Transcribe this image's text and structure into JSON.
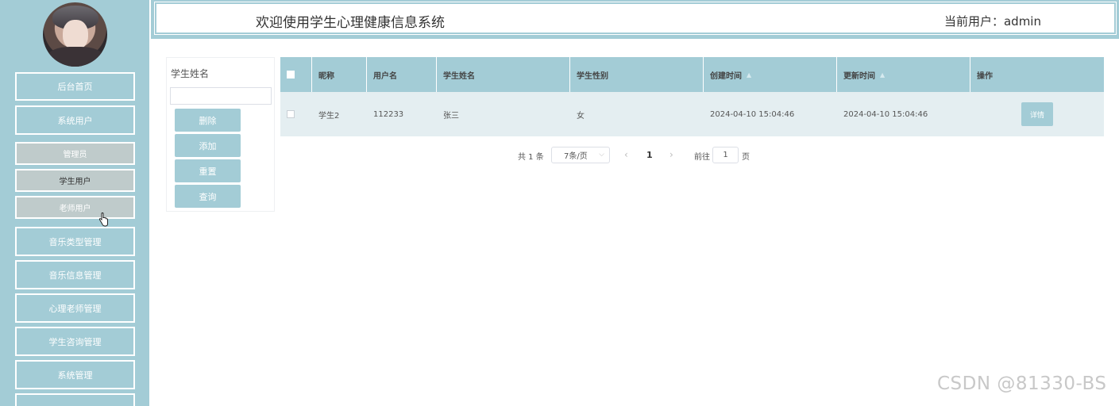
{
  "header": {
    "title": "欢迎使用学生心理健康信息系统",
    "current_user": "当前用户：admin"
  },
  "sidebar": {
    "items": [
      {
        "label": "后台首页"
      },
      {
        "label": "系统用户"
      },
      {
        "label": "管理员"
      },
      {
        "label": "学生用户"
      },
      {
        "label": "老师用户"
      },
      {
        "label": "音乐类型管理"
      },
      {
        "label": "音乐信息管理"
      },
      {
        "label": "心理老师管理"
      },
      {
        "label": "学生咨询管理"
      },
      {
        "label": "系统管理"
      }
    ]
  },
  "search": {
    "label": "学生姓名",
    "value": "",
    "buttons": {
      "delete": "删除",
      "add": "添加",
      "reset": "重置",
      "query": "查询"
    }
  },
  "table": {
    "columns": [
      "昵称",
      "用户名",
      "学生姓名",
      "学生性别",
      "创建时间",
      "更新时间",
      "操作"
    ],
    "rows": [
      {
        "nickname": "学生2",
        "username": "112233",
        "name": "张三",
        "gender": "女",
        "created": "2024-04-10 15:04:46",
        "updated": "2024-04-10 15:04:46",
        "action": "详情"
      }
    ]
  },
  "pagination": {
    "total": "共 1 条",
    "page_size": "7条/页",
    "current_page": "1",
    "goto_label": "前往",
    "goto_value": "1",
    "page_suffix": "页"
  },
  "watermark": "CSDN @81330-BS",
  "colors": {
    "accent": "#a3ccd6",
    "row": "#e4eef1"
  }
}
